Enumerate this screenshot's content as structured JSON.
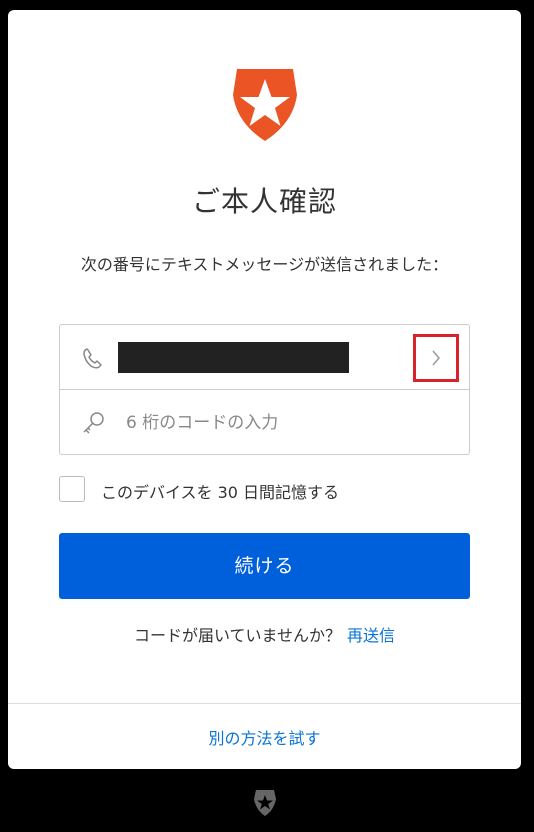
{
  "colors": {
    "brand_orange": "#eb5424",
    "primary_button": "#0060dc",
    "link": "#0a74d6",
    "highlight_box": "#d8232a"
  },
  "header": {
    "logo_icon": "auth0-shield-star-icon",
    "title": "ご本人確認",
    "description": "次の番号にテキストメッセージが送信されました："
  },
  "form": {
    "phone": {
      "icon": "phone-icon",
      "value_masked": true,
      "action_icon": "chevron-right-icon"
    },
    "code": {
      "icon": "key-icon",
      "placeholder": "6 桁のコードの入力",
      "value": ""
    },
    "remember": {
      "label": "このデバイスを 30 日間記憶する",
      "checked": false
    },
    "continue_label": "続ける"
  },
  "resend": {
    "prompt": "コードが届いていませんか？",
    "link": "再送信"
  },
  "footer": {
    "alt_method_link": "別の方法を試す",
    "logo_icon": "auth0-badge-icon"
  }
}
